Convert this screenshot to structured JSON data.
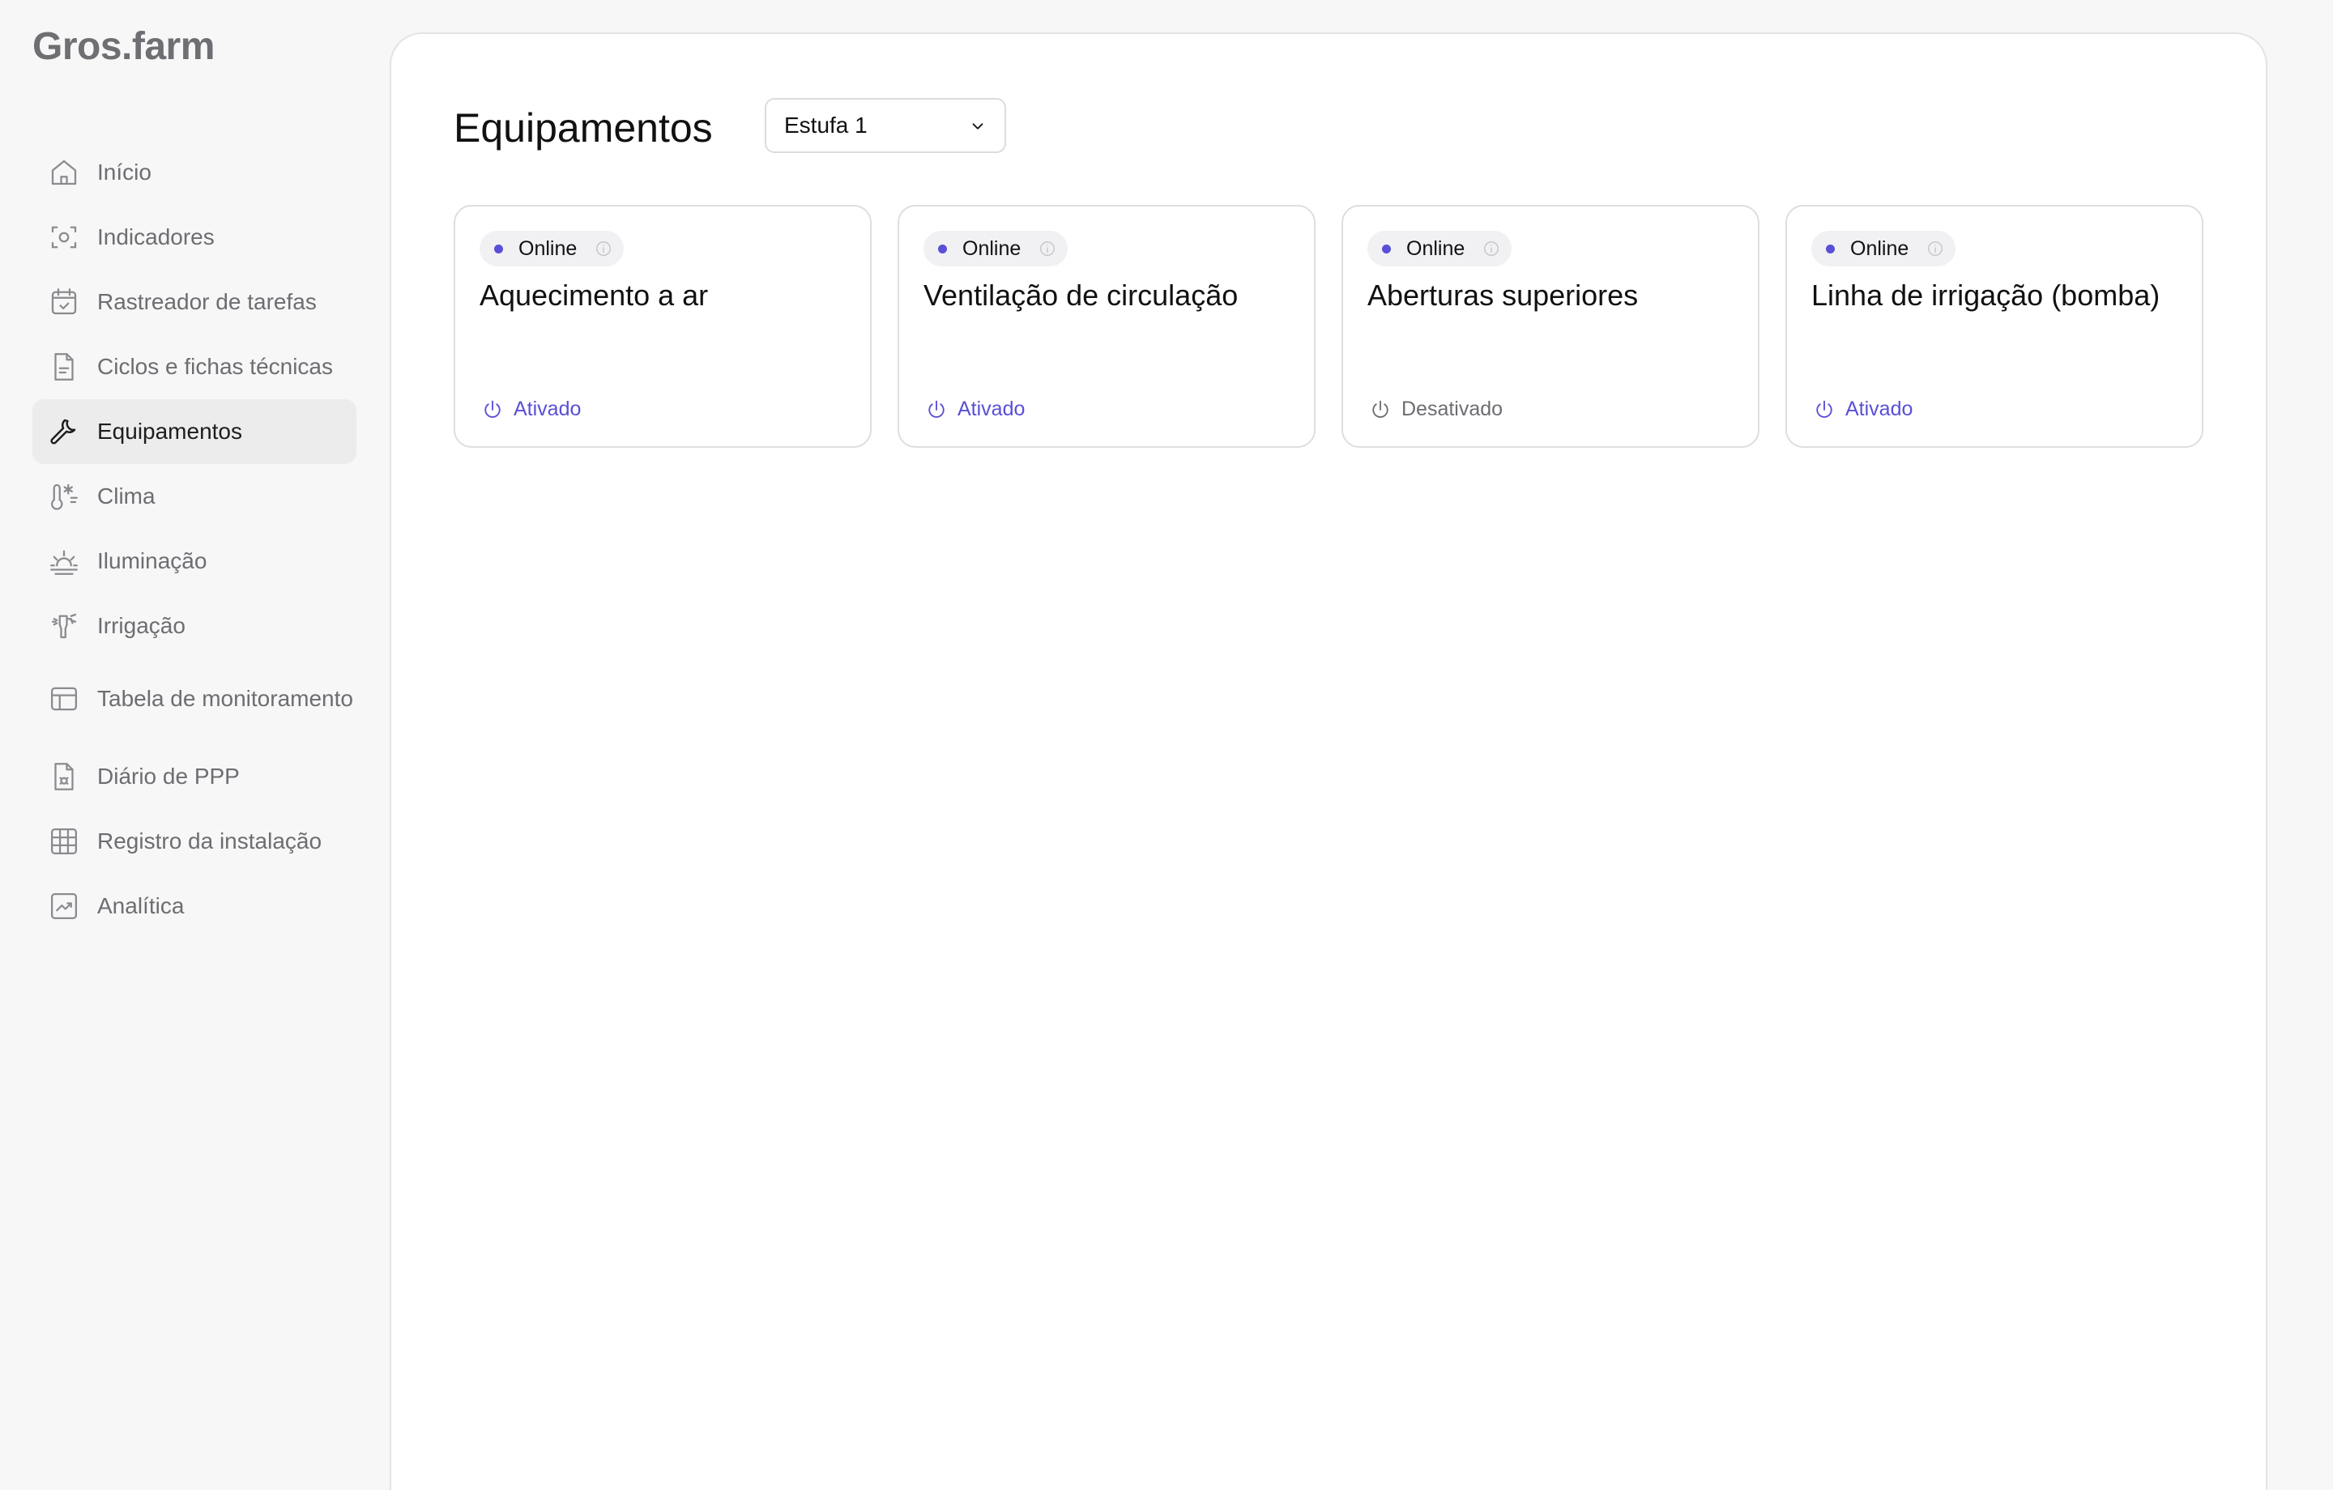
{
  "app": {
    "logo": "Gros.farm"
  },
  "sidebar": {
    "items": [
      {
        "label": "Início",
        "icon": "home-icon"
      },
      {
        "label": "Indicadores",
        "icon": "camera-icon"
      },
      {
        "label": "Rastreador de tarefas",
        "icon": "calendar-check-icon"
      },
      {
        "label": "Ciclos e fichas técnicas",
        "icon": "document-icon"
      },
      {
        "label": "Equipamentos",
        "icon": "wrench-icon",
        "active": true
      },
      {
        "label": "Clima",
        "icon": "thermometer-icon"
      },
      {
        "label": "Iluminação",
        "icon": "sunrise-icon"
      },
      {
        "label": "Irrigação",
        "icon": "sprinkler-icon"
      },
      {
        "label": "Tabela de monitoramento",
        "icon": "table-icon"
      },
      {
        "label": "Diário de PPP",
        "icon": "bug-document-icon"
      },
      {
        "label": "Registro da instalação",
        "icon": "grid-icon"
      },
      {
        "label": "Analítica",
        "icon": "chart-icon"
      }
    ]
  },
  "main": {
    "title": "Equipamentos",
    "select": {
      "value": "Estufa 1"
    },
    "cards": [
      {
        "status": "Online",
        "title": "Aquecimento a ar",
        "state_label": "Ativado",
        "active": true
      },
      {
        "status": "Online",
        "title": "Ventilação de circulação",
        "state_label": "Ativado",
        "active": true
      },
      {
        "status": "Online",
        "title": "Aberturas superiores",
        "state_label": "Desativado",
        "active": false
      },
      {
        "status": "Online",
        "title": "Linha de irrigação (bomba)",
        "state_label": "Ativado",
        "active": true
      }
    ]
  },
  "colors": {
    "accent": "#5a4fd6",
    "muted_text": "#6d6d72",
    "active_bg": "#ececec",
    "background": "#f7f7f7"
  }
}
